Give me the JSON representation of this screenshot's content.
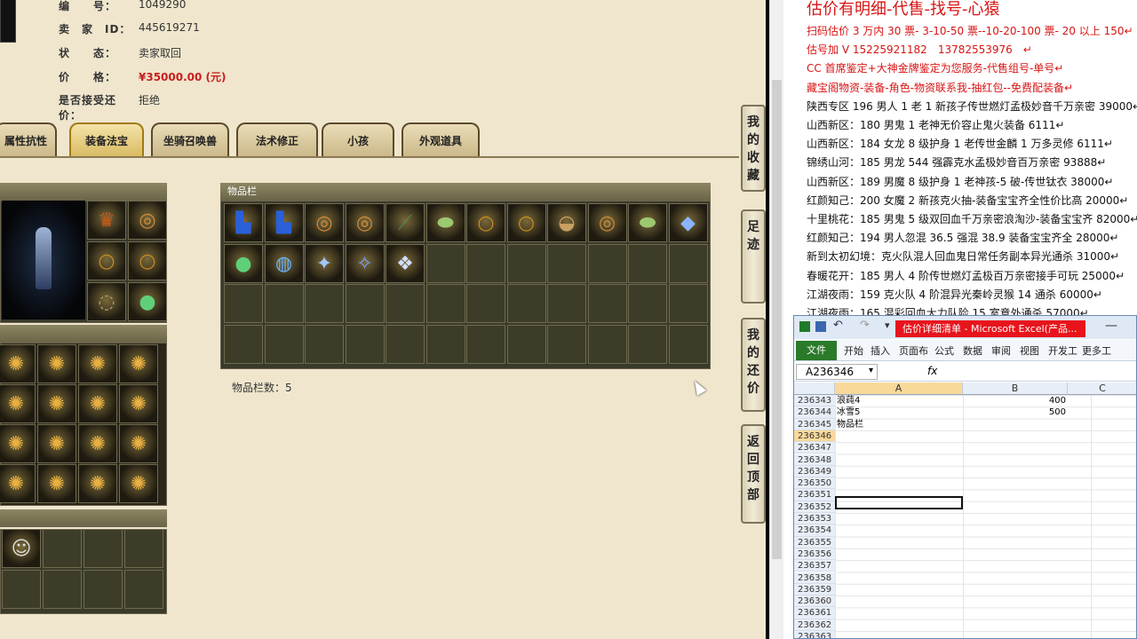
{
  "listing": {
    "rows": [
      {
        "key": "编　　号：",
        "value": "1049290"
      },
      {
        "key": "卖　家　ID：",
        "value": "445619271"
      },
      {
        "key": "状　　态：",
        "value": "卖家取回"
      },
      {
        "key": "价　　格：",
        "value": "¥35000.00 (元)"
      },
      {
        "key": "是否接受还价：",
        "value": "拒绝"
      }
    ]
  },
  "tabs": [
    "属性抗性",
    "装备法宝",
    "坐骑召唤兽",
    "法术修正",
    "小孩",
    "外观道具"
  ],
  "inventory": {
    "header": "物品栏",
    "count_label": "物品栏数：5"
  },
  "sidebar": [
    "我的收藏",
    "足迹",
    "我的还价",
    "返回顶部"
  ],
  "right_panel": {
    "lines": [
      {
        "text": "估价有明细-代售-找号-心猿",
        "color": "#d81414"
      },
      {
        "text": "扫码估价 3 万内 30 票- 3-10-50 票--10-20-100 票- 20 以上 150↵",
        "color": "#d81414"
      },
      {
        "text": "估号加 V 15225921182　13782553976　↵",
        "color": "#d81414"
      },
      {
        "text": "CC 首席鉴定+大神金牌鉴定为您服务-代售组号-单号↵",
        "color": "#d81414"
      },
      {
        "text": "藏宝阁物资-装备-角色-物资联系我-抽红包--免费配装备↵",
        "color": "#d81414"
      },
      {
        "text": "陕西专区 196 男人 1 老 1 新孩子传世燃灯孟极妙音千万亲密 39000↵",
        "color": "#111111"
      },
      {
        "text": "山西新区：180 男鬼 1 老神无价容止鬼火装备 6111↵",
        "color": "#111111"
      },
      {
        "text": "山西新区：184 女龙 8 级护身 1 老传世金麟 1 万多灵修 6111↵",
        "color": "#111111"
      },
      {
        "text": "锦绣山河：185 男龙 544 强霹克水孟极妙音百万亲密 93888↵",
        "color": "#111111"
      },
      {
        "text": "山西新区：189 男魔 8 级护身 1 老神孩-5 破-传世钛衣 38000↵",
        "color": "#111111"
      },
      {
        "text": "红颜知己：200 女魔 2 新孩克火抽-装备宝宝齐全性价比高 20000↵",
        "color": "#111111"
      },
      {
        "text": "十里桃花：185 男鬼 5 级双回血千万亲密浪淘沙-装备宝宝齐 82000↵",
        "color": "#111111"
      },
      {
        "text": "红颜知己：194 男人忽混 36.5 强混 38.9 装备宝宝齐全 28000↵",
        "color": "#111111"
      },
      {
        "text": "新到太初幻境：克火队混人回血鬼日常任务副本异光通杀 31000↵",
        "color": "#111111"
      },
      {
        "text": "春暖花开：185 男人 4 阶传世燃灯孟极百万亲密接手可玩 25000↵",
        "color": "#111111"
      },
      {
        "text": "江湖夜雨：159 克火队 4 阶混异光秦岭灵猴 14 通杀 60000↵",
        "color": "#111111"
      },
      {
        "text": "江湖夜雨：165 混彩回血大力队险 15 室意外通杀 57000↵",
        "color": "#111111"
      }
    ]
  },
  "excel": {
    "title": "估价详细清单 - Microsoft Excel(产品...",
    "ribbon_tabs": [
      "开始",
      "插入",
      "页面布",
      "公式",
      "数据",
      "审阅",
      "视图",
      "开发工",
      "更多工"
    ],
    "file_tab": "文件",
    "name_box": "A236346",
    "fx": "fx",
    "columns": [
      "A",
      "B",
      "C"
    ],
    "rows": [
      {
        "n": "236343",
        "a": "浪莼4",
        "b": "400"
      },
      {
        "n": "236344",
        "a": "冰雪5",
        "b": "500"
      },
      {
        "n": "236345",
        "a": "物品栏",
        "b": ""
      },
      {
        "n": "236346",
        "a": "",
        "b": ""
      },
      {
        "n": "236347",
        "a": "",
        "b": ""
      },
      {
        "n": "236348",
        "a": "",
        "b": ""
      },
      {
        "n": "236349",
        "a": "",
        "b": ""
      },
      {
        "n": "236350",
        "a": "",
        "b": ""
      },
      {
        "n": "236351",
        "a": "",
        "b": ""
      },
      {
        "n": "236352",
        "a": "",
        "b": ""
      },
      {
        "n": "236353",
        "a": "",
        "b": ""
      },
      {
        "n": "236354",
        "a": "",
        "b": ""
      },
      {
        "n": "236355",
        "a": "",
        "b": ""
      },
      {
        "n": "236356",
        "a": "",
        "b": ""
      },
      {
        "n": "236357",
        "a": "",
        "b": ""
      },
      {
        "n": "236358",
        "a": "",
        "b": ""
      },
      {
        "n": "236359",
        "a": "",
        "b": ""
      },
      {
        "n": "236360",
        "a": "",
        "b": ""
      },
      {
        "n": "236361",
        "a": "",
        "b": ""
      },
      {
        "n": "236362",
        "a": "",
        "b": ""
      },
      {
        "n": "236363",
        "a": "",
        "b": ""
      }
    ]
  },
  "icons": {
    "equip_slots": [
      "helmet-icon",
      "necklace-icon",
      "ring-icon",
      "ring-icon",
      "belt-icon",
      "orb-icon"
    ],
    "inventory_items": [
      "boot-icon",
      "boot-icon",
      "necklace-icon",
      "necklace-icon",
      "sword-icon",
      "shoe-icon",
      "ring-icon",
      "ring-icon",
      "bun-icon",
      "necklace-icon",
      "shoe-icon",
      "gem-icon",
      "orb-icon",
      "shell-icon",
      "staff-icon",
      "dragon-icon",
      "spirit-icon"
    ]
  }
}
